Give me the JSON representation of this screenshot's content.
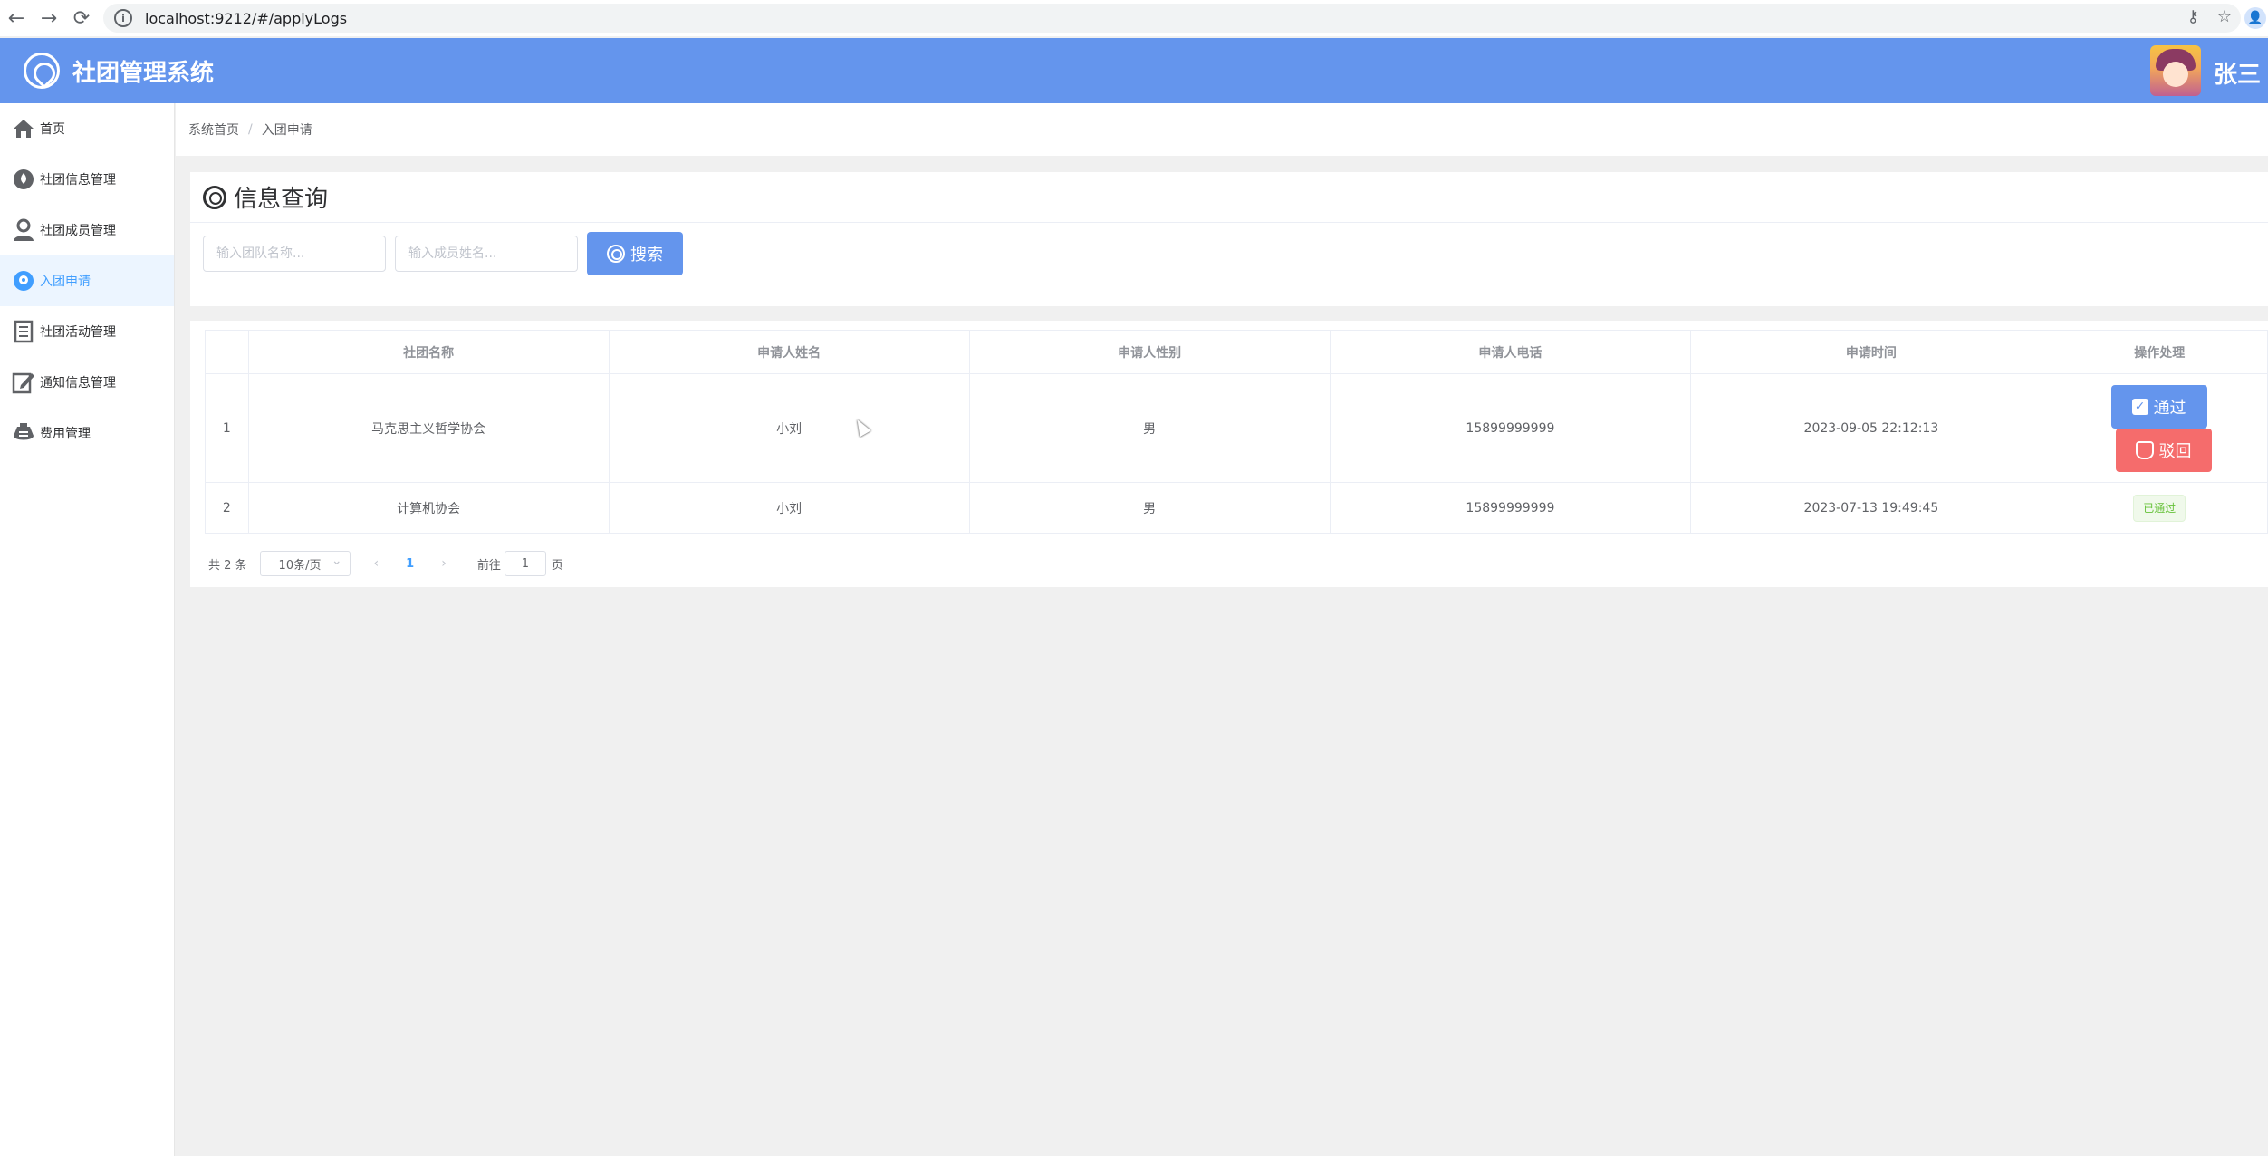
{
  "browser": {
    "url": "localhost:9212/#/applyLogs",
    "back_icon": "←",
    "forward_icon": "→",
    "reload_icon": "⟳",
    "info_icon": "i",
    "key_icon": "⚷",
    "star_icon": "☆",
    "profile_icon": "👤"
  },
  "header": {
    "title": "社团管理系统",
    "username": "张三",
    "bg_color": "#6495ed"
  },
  "sidebar": {
    "items": [
      {
        "label": "首页",
        "icon": "home-icon"
      },
      {
        "label": "社团信息管理",
        "icon": "drop-icon"
      },
      {
        "label": "社团成员管理",
        "icon": "user-icon"
      },
      {
        "label": "入团申请",
        "icon": "location-icon",
        "active": true
      },
      {
        "label": "社团活动管理",
        "icon": "document-icon"
      },
      {
        "label": "通知信息管理",
        "icon": "edit-icon"
      },
      {
        "label": "费用管理",
        "icon": "money-icon"
      }
    ]
  },
  "breadcrumb": {
    "home": "系统首页",
    "separator": "/",
    "current": "入团申请"
  },
  "search": {
    "title": "信息查询",
    "team_placeholder": "输入团队名称...",
    "member_placeholder": "输入成员姓名...",
    "button_label": "搜索"
  },
  "table": {
    "headers": [
      "",
      "社团名称",
      "申请人姓名",
      "申请人性别",
      "申请人电话",
      "申请时间",
      "操作处理"
    ],
    "rows": [
      {
        "index": "1",
        "club": "马克思主义哲学协会",
        "name": "小刘",
        "gender": "男",
        "phone": "15899999999",
        "time": "2023-09-05 22:12:13"
      },
      {
        "index": "2",
        "club": "计算机协会",
        "name": "小刘",
        "gender": "男",
        "phone": "15899999999",
        "time": "2023-07-13 19:49:45"
      }
    ],
    "pass_label": "通过",
    "reject_label": "驳回",
    "passed_tag": "已通过"
  },
  "pagination": {
    "total": "共 2 条",
    "page_size": "10条/页",
    "prev": "‹",
    "current": "1",
    "next": "›",
    "goto_label": "前往",
    "goto_value": "1",
    "goto_suffix": "页"
  }
}
